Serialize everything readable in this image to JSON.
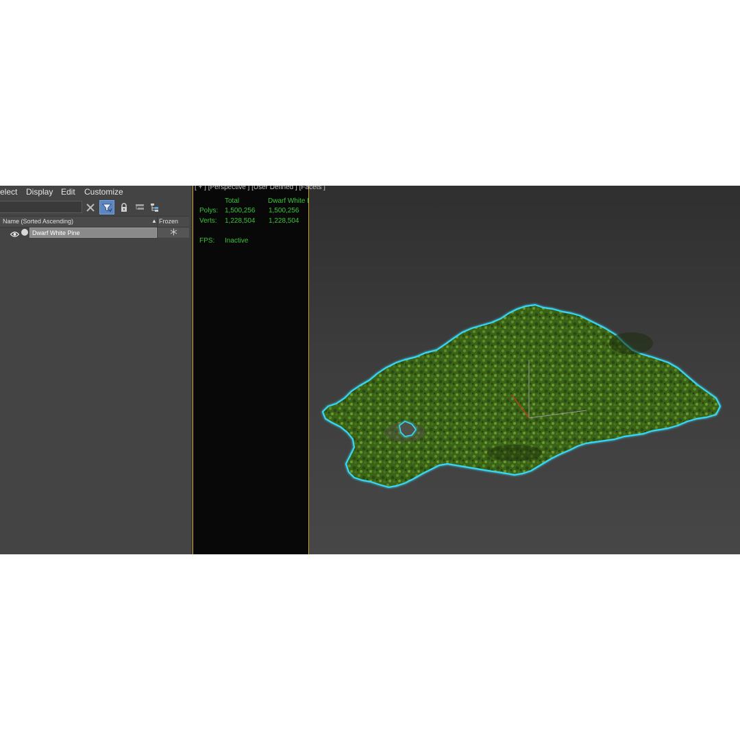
{
  "menubar": {
    "items": [
      "elect",
      "Display",
      "Edit",
      "Customize"
    ]
  },
  "toolbar": {
    "icons": [
      "clear-search-icon",
      "filter-icon",
      "lock-icon",
      "hierarchy-icon",
      "tree-icon"
    ]
  },
  "columns": {
    "name": "Name (Sorted Ascending)",
    "sort_indicator": "▲",
    "frozen": "Frozen"
  },
  "objects": [
    {
      "name": "Dwarf White Pine",
      "visible": true,
      "frozen_icon": "snowflake-icon"
    }
  ],
  "viewport": {
    "label": "[ + ] [Perspective ] [User Defined ] [Facets ]"
  },
  "stats": {
    "header_total": "Total",
    "header_object": "Dwarf White Pine",
    "polys_label": "Polys:",
    "polys_total": "1,500,256",
    "polys_object": "1,500,256",
    "verts_label": "Verts:",
    "verts_total": "1,228,504",
    "verts_object": "1,228,504",
    "fps_label": "FPS:",
    "fps_value": "Inactive"
  },
  "colors": {
    "selection_outline": "#39d6f5",
    "stats_text": "#39c639",
    "viewport_border": "#c9a227",
    "foliage": "#3e6a1d"
  }
}
